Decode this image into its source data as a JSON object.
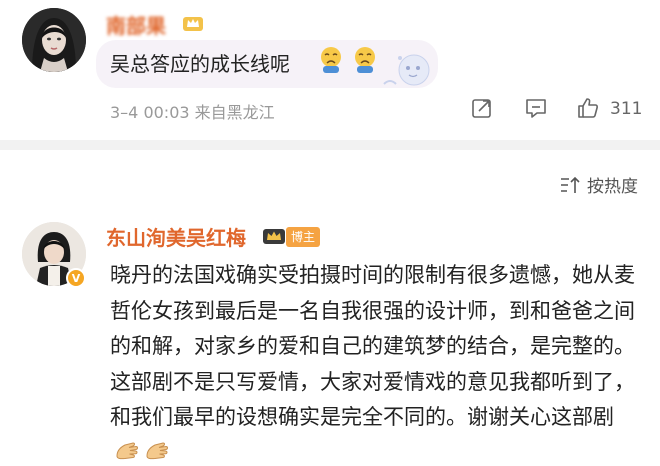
{
  "top_comment": {
    "username": "南部果",
    "text": "吴总答应的成长线呢",
    "meta": "3–4 00:03  来自黑龙江",
    "like_count": "311",
    "icons": [
      "share-icon",
      "comment-icon",
      "like-icon"
    ]
  },
  "sort": {
    "label": "按热度",
    "icon": "sort-icon"
  },
  "reply": {
    "username": "东山洵美吴红梅",
    "badge": "博主",
    "verified_icon": "v-badge-icon",
    "text_main": "晓丹的法国戏确实受拍摄时间的限制有很多遗憾，她从麦哲伦女孩到最后是一名自我很强的设计师，到和爸爸之间的和解，对家乡的爱和自己的建筑梦的结合，是完整的。这部剧不是只写爱情，大家对爱情戏的意见我都听到了，和我们最早的设想确实是完全不同的。谢谢关心这部剧",
    "trailing_emojis": [
      "clap-hands-icon",
      "clap-hands-icon"
    ]
  },
  "colors": {
    "username": "#e0672d",
    "badge_bg": "#f5a342",
    "meta": "#999999",
    "divider": "#f2f2f2",
    "bubble": "#f6f2f8"
  }
}
